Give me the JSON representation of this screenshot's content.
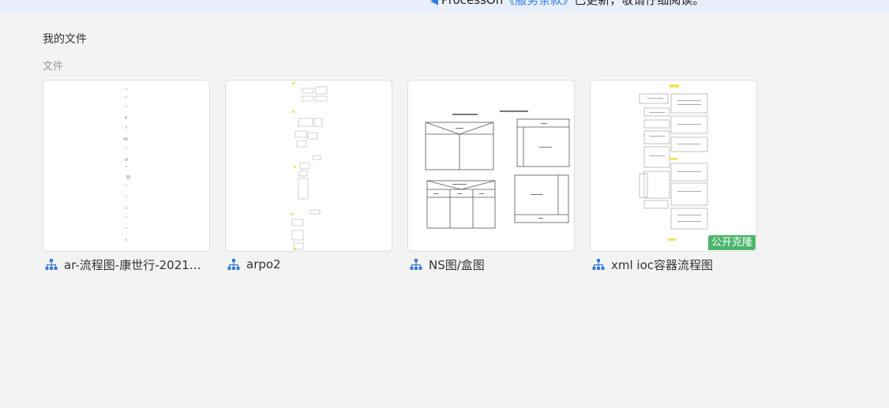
{
  "notice": {
    "prefix": "ProcessOn",
    "link": "《服务条款》",
    "suffix": "已更新，敬请仔细阅读。"
  },
  "breadcrumb": {
    "title": "我的文件"
  },
  "section": {
    "label": "文件"
  },
  "files": [
    {
      "name": "ar-流程图-康世行-2021…",
      "icon": "flowchart-icon",
      "badge": ""
    },
    {
      "name": "arpo2",
      "icon": "flowchart-icon",
      "badge": ""
    },
    {
      "name": "NS图/盒图",
      "icon": "flowchart-icon",
      "badge": ""
    },
    {
      "name": "xml ioc容器流程图",
      "icon": "flowchart-icon",
      "badge": "公开克隆"
    }
  ],
  "colors": {
    "accent": "#2d7be5",
    "badge": "#4cb56c",
    "background": "#f3f3f3"
  }
}
